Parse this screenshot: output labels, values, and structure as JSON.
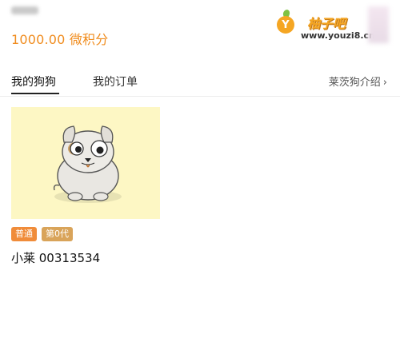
{
  "header": {
    "balance": "1000.00 微积分"
  },
  "watermark": {
    "logo_letter": "Y",
    "title": "柚子吧",
    "url": "www.youzi8.cn"
  },
  "tabs": [
    {
      "label": "我的狗狗",
      "active": true
    },
    {
      "label": "我的订单",
      "active": false
    }
  ],
  "intro_link": {
    "label": "莱茨狗介绍",
    "icon": "chevron-right-icon"
  },
  "dog": {
    "badges": [
      "普通",
      "第0代"
    ],
    "name": "小莱 00313534",
    "image_background": "#fdf7c4"
  },
  "colors": {
    "accent": "#f08c1e",
    "badge_level": "#f08c3a",
    "badge_gen": "#d9a45a"
  }
}
